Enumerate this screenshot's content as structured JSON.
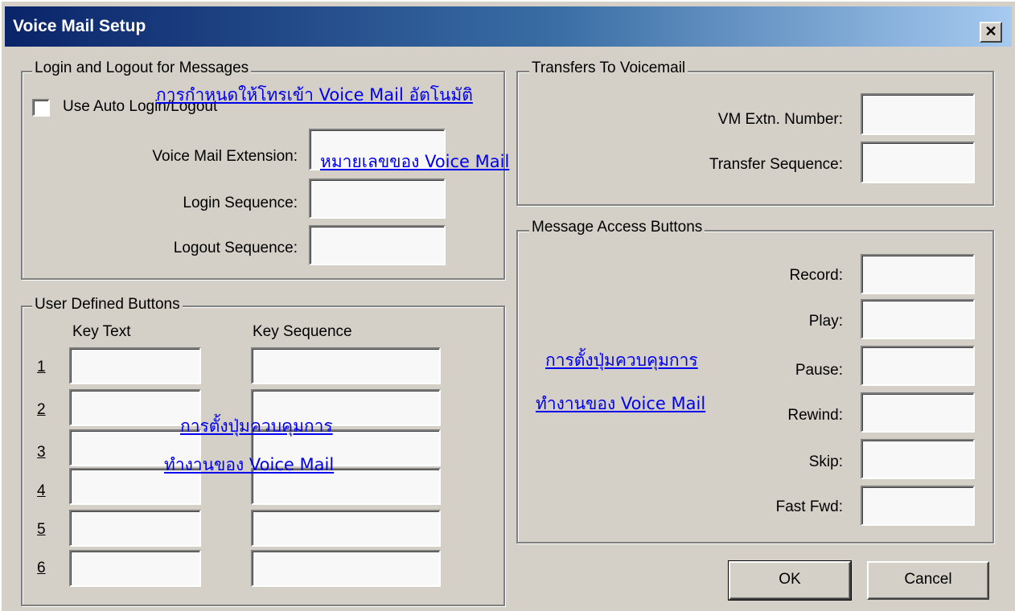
{
  "window": {
    "title": "Voice Mail Setup",
    "close_glyph": "✕"
  },
  "login_group": {
    "legend": "Login and Logout for Messages",
    "auto_login_label": "Use Auto Login/Logout",
    "auto_login_checked": false,
    "voice_mail_extension_label": "Voice Mail Extension:",
    "login_sequence_label": "Login Sequence:",
    "logout_sequence_label": "Logout Sequence:",
    "voice_mail_extension_value": "",
    "login_sequence_value": "",
    "logout_sequence_value": ""
  },
  "transfers_group": {
    "legend": "Transfers To Voicemail",
    "vm_extn_label": "VM Extn. Number:",
    "transfer_sequence_label": "Transfer Sequence:",
    "vm_extn_value": "",
    "transfer_sequence_value": ""
  },
  "user_buttons_group": {
    "legend": "User Defined Buttons",
    "col_key_text": "Key Text",
    "col_key_sequence": "Key Sequence",
    "rows": [
      {
        "num": "1",
        "key_text": "",
        "key_sequence": ""
      },
      {
        "num": "2",
        "key_text": "",
        "key_sequence": ""
      },
      {
        "num": "3",
        "key_text": "",
        "key_sequence": ""
      },
      {
        "num": "4",
        "key_text": "",
        "key_sequence": ""
      },
      {
        "num": "5",
        "key_text": "",
        "key_sequence": ""
      },
      {
        "num": "6",
        "key_text": "",
        "key_sequence": ""
      }
    ]
  },
  "message_access_group": {
    "legend": "Message Access Buttons",
    "record_label": "Record:",
    "play_label": "Play:",
    "pause_label": "Pause:",
    "rewind_label": "Rewind:",
    "skip_label": "Skip:",
    "fast_fwd_label": "Fast Fwd:"
  },
  "buttons": {
    "ok": "OK",
    "cancel": "Cancel"
  },
  "annotations": {
    "auto_login": "การกำหนดให้โทรเข้า Voice Mail อัตโนมัติ",
    "vm_number": "หมายเลขของ Voice Mail",
    "user_buttons_line1": "การตั้งปุ่มควบคุมการ",
    "user_buttons_line2": "ทำงานของ Voice Mail",
    "access_line1": "การตั้งปุ่มควบคุมการ",
    "access_line2": "ทำงานของ Voice Mail"
  },
  "colors": {
    "face": "#d4d0c8",
    "title_start": "#0a246a",
    "title_end": "#a6caf0",
    "annotation": "#0000ee"
  }
}
